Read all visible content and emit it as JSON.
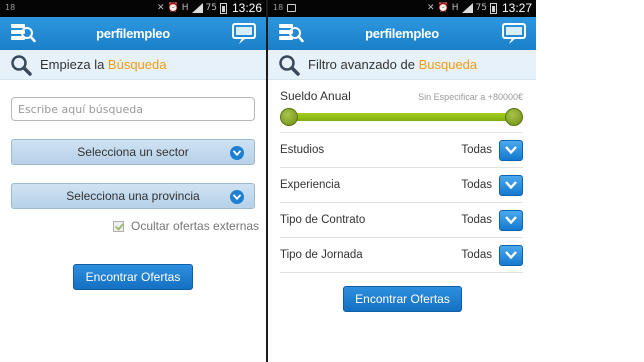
{
  "left_screen": {
    "status_bar": {
      "left_text": "18",
      "network": "H",
      "battery": "75",
      "time": "13:26"
    },
    "app_bar": {
      "brand": "perfilempleo"
    },
    "section": {
      "prefix": "Empieza la ",
      "accent": "Búsqueda",
      "accent_color": "#f39c12"
    },
    "search": {
      "placeholder": "Escribe aquí búsqueda",
      "value": ""
    },
    "sector_select": {
      "label": "Selecciona un sector"
    },
    "province_select": {
      "label": "Selecciona una provincia"
    },
    "hide_external": {
      "label": "Ocultar ofertas externas",
      "checked": true
    },
    "submit": {
      "label": "Encontrar Ofertas"
    }
  },
  "right_screen": {
    "status_bar": {
      "left_text": "18",
      "network": "H",
      "battery": "75",
      "time": "13:27"
    },
    "app_bar": {
      "brand": "perfilempleo"
    },
    "section": {
      "prefix": "Filtro avanzado de ",
      "accent": "Busqueda",
      "accent_color": "#f39c12"
    },
    "salary": {
      "label": "Sueldo Anual",
      "range_text": "Sin Especificar a +80000€",
      "slider_min_fraction": 0.0,
      "slider_max_fraction": 1.0
    },
    "filters": [
      {
        "label": "Estudios",
        "value": "Todas"
      },
      {
        "label": "Experiencia",
        "value": "Todas"
      },
      {
        "label": "Tipo de Contrato",
        "value": "Todas"
      },
      {
        "label": "Tipo de Jornada",
        "value": "Todas"
      }
    ],
    "submit": {
      "label": "Encontrar Ofertas"
    }
  },
  "colors": {
    "app_bar": "#1a7fc8",
    "accent": "#f39c12",
    "button": "#1470c2",
    "slider": "#8fbc14"
  },
  "icons": [
    "server-search-icon",
    "chat-bubble-icon",
    "search-magnifier-icon",
    "chevron-down-icon",
    "checkbox-check-icon",
    "mute-icon",
    "alarm-icon",
    "battery-icon",
    "signal-icon"
  ]
}
